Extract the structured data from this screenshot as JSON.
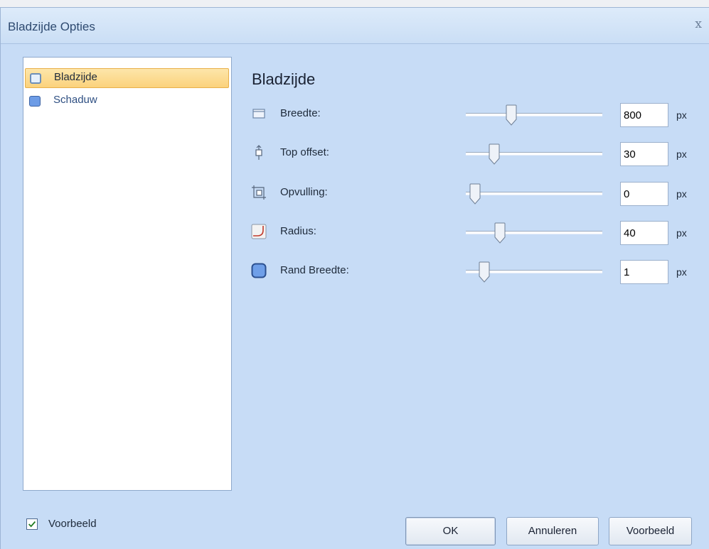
{
  "window": {
    "title": "Bladzijde Opties",
    "close_glyph": "x"
  },
  "nav": {
    "items": [
      {
        "label": "Bladzijde",
        "icon": "page-icon",
        "selected": true
      },
      {
        "label": "Schaduw",
        "icon": "shadow-icon",
        "selected": false
      }
    ]
  },
  "section": {
    "title": "Bladzijde"
  },
  "settings": [
    {
      "label": "Breedte:",
      "icon": "width-icon",
      "value": "800",
      "unit": "px",
      "slider_fraction": 0.32
    },
    {
      "label": "Top offset:",
      "icon": "top-offset-icon",
      "value": "30",
      "unit": "px",
      "slider_fraction": 0.18
    },
    {
      "label": "Opvulling:",
      "icon": "padding-icon",
      "value": "0",
      "unit": "px",
      "slider_fraction": 0.03
    },
    {
      "label": "Radius:",
      "icon": "radius-icon",
      "value": "40",
      "unit": "px",
      "slider_fraction": 0.23
    },
    {
      "label": "Rand Breedte:",
      "icon": "border-width-icon",
      "value": "1",
      "unit": "px",
      "slider_fraction": 0.1
    }
  ],
  "preview_checkbox": {
    "label": "Voorbeeld",
    "checked": true
  },
  "buttons": {
    "ok": "OK",
    "cancel": "Annuleren",
    "preview": "Voorbeeld"
  },
  "colors": {
    "selected_item": "#fbd27c",
    "window_bg": "#c7dcf6",
    "accent": "#3c63a4"
  }
}
